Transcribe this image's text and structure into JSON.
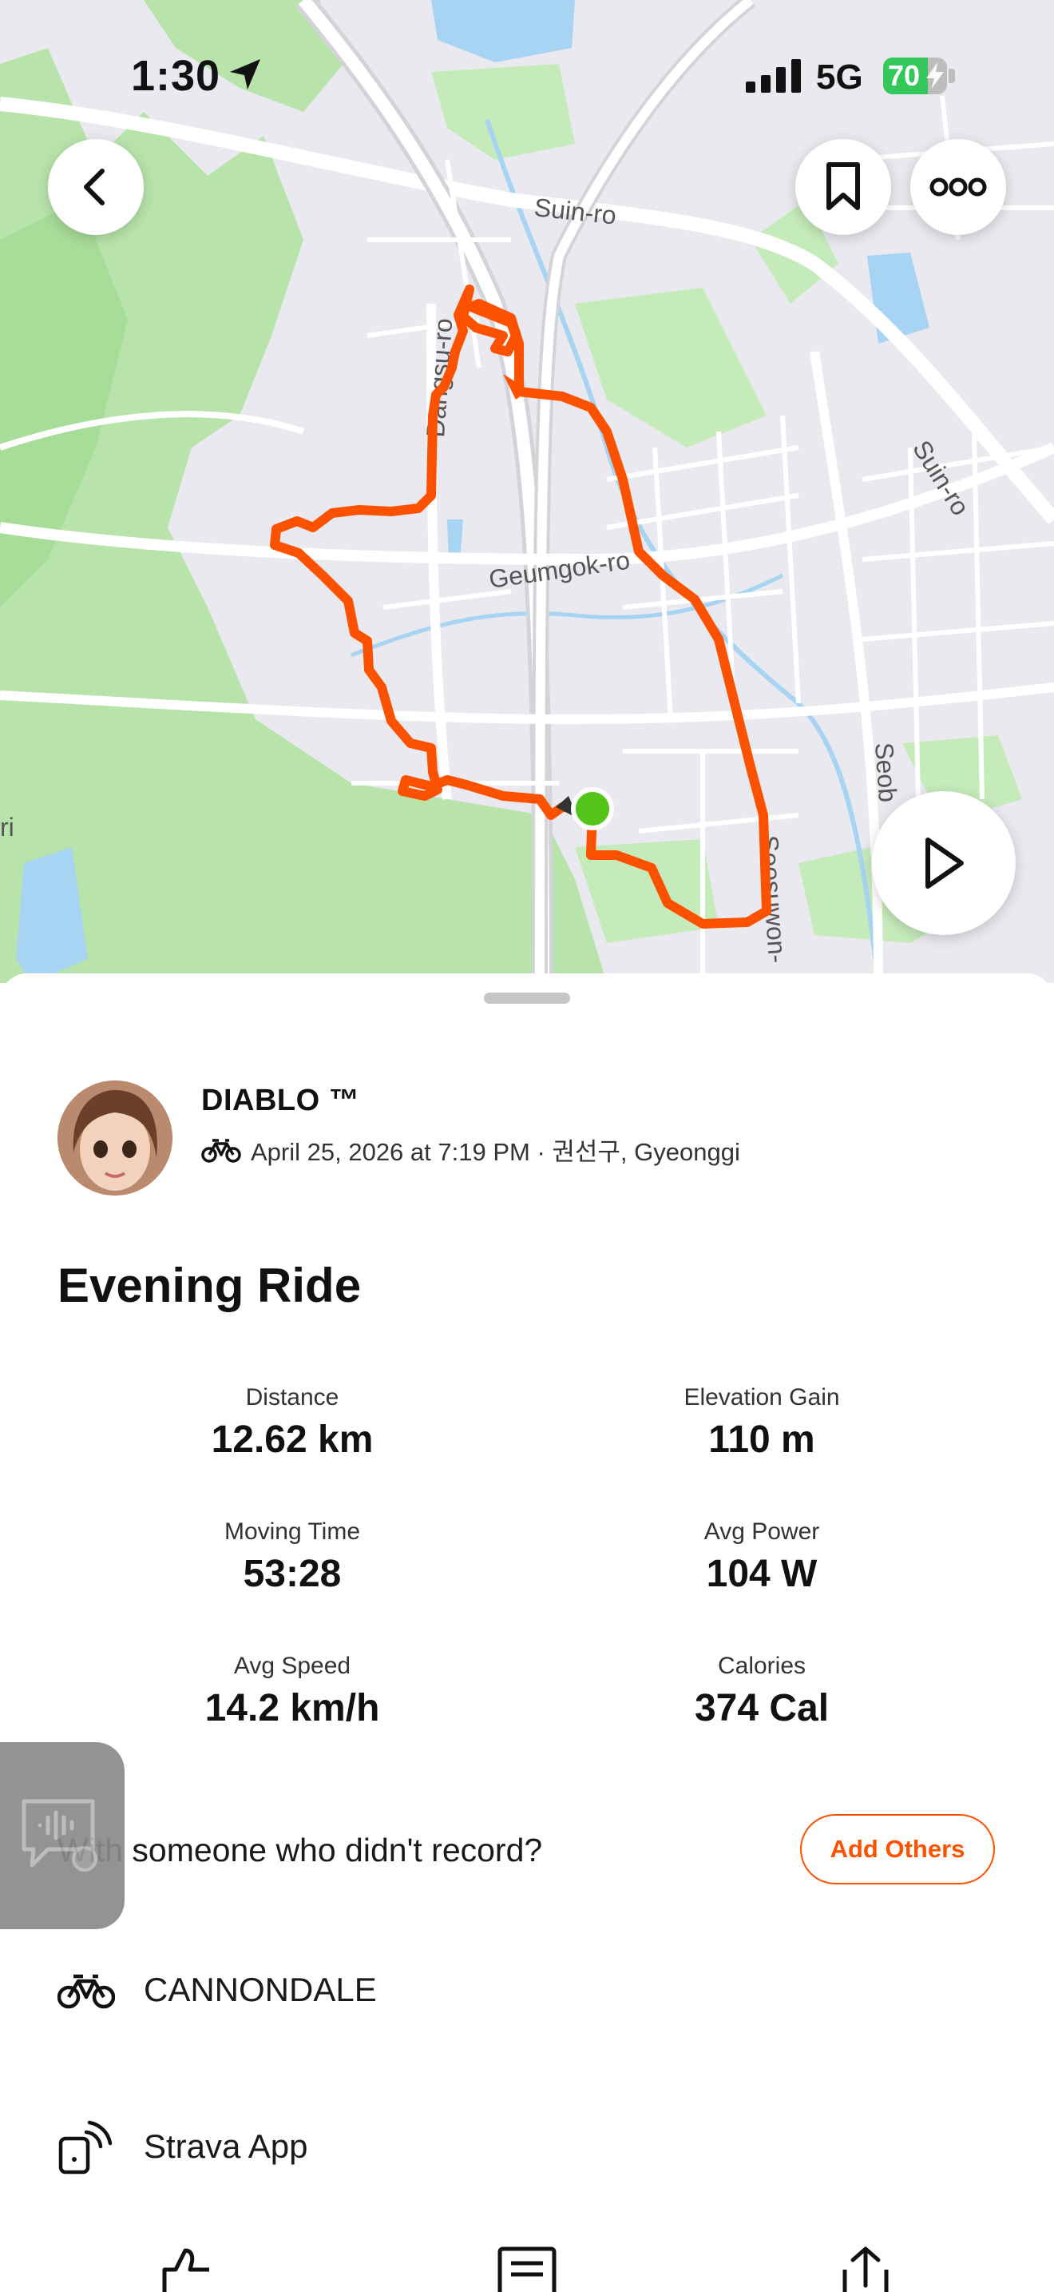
{
  "status_bar": {
    "time": "1:30",
    "network": "5G",
    "battery_level": "70",
    "battery_fraction": 0.7
  },
  "map": {
    "labels": {
      "suin_ro_1": "Suin-ro",
      "suin_ro_2": "Suin-ro",
      "dangsu_ro": "Dangsu-ro",
      "geumgok_ro": "Geumgok-ro",
      "seosuwon": "Seosuwon-",
      "seob": "Seob",
      "edge_r": "ri"
    },
    "route_color": "#fc5200",
    "start_color": "#52c41a"
  },
  "activity": {
    "athlete_name": "DIABLO ™",
    "meta": "April 25, 2026 at 7:19 PM · 권선구, Gyeonggi",
    "title": "Evening Ride",
    "stats": [
      {
        "label": "Distance",
        "value": "12.62 km"
      },
      {
        "label": "Elevation Gain",
        "value": "110 m"
      },
      {
        "label": "Moving Time",
        "value": "53:28"
      },
      {
        "label": "Avg Power",
        "value": "104 W"
      },
      {
        "label": "Avg Speed",
        "value": "14.2 km/h"
      },
      {
        "label": "Calories",
        "value": "374 Cal"
      }
    ],
    "with_others_text": "With someone who didn't record?",
    "add_others_label": "Add Others",
    "gear": "CANNONDALE",
    "device": "Strava App"
  },
  "icons": {
    "back": "chevron-left-icon",
    "bookmark": "bookmark-icon",
    "more": "more-dots-icon",
    "play": "play-icon",
    "bike": "bike-icon",
    "device": "device-signal-icon",
    "kudos": "thumbs-up-icon",
    "comment": "comment-icon",
    "share": "share-icon"
  },
  "colors": {
    "accent": "#fc5200",
    "park": "#b5e3a8",
    "water": "#a6d4f2"
  }
}
